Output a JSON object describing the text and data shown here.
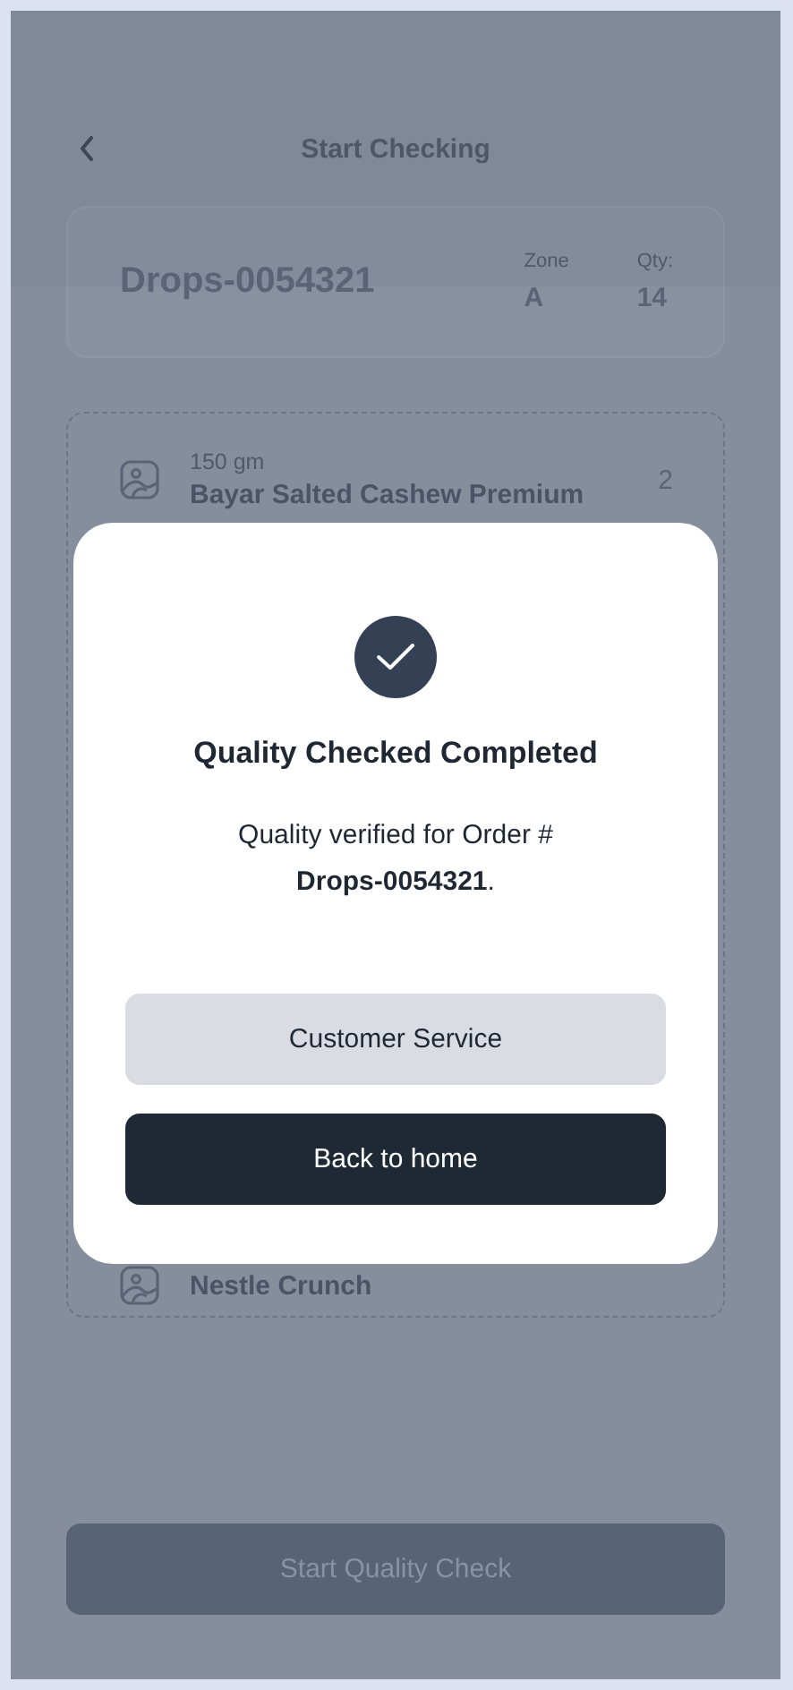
{
  "header": {
    "title": "Start Checking"
  },
  "order": {
    "id": "Drops-0054321",
    "zone_label": "Zone",
    "zone": "A",
    "qty_label": "Qty:",
    "qty": "14"
  },
  "items": [
    {
      "weight": "150 gm",
      "name": "Bayar Salted Cashew Premium",
      "qty": "2"
    },
    {
      "name": "Nestle Crunch"
    }
  ],
  "footer_button": "Start Quality Check",
  "dialog": {
    "title": "Quality Checked Completed",
    "message": "Quality verified for Order # **Drops-0054321**.",
    "buttons": [
      {
        "label": "Customer Service",
        "kind": "secondary"
      },
      {
        "label": "Back to home",
        "kind": "primary"
      }
    ]
  }
}
